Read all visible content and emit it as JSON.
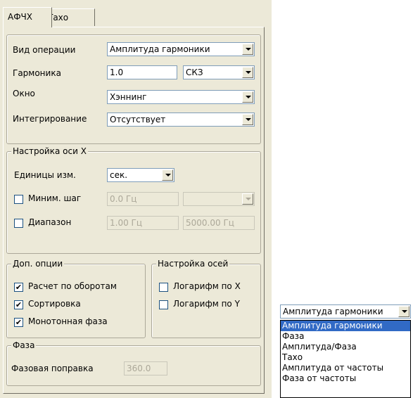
{
  "tabs": [
    {
      "label": "АФЧХ",
      "active": true
    },
    {
      "label": "Тахо",
      "active": false
    }
  ],
  "operation": {
    "vid_label": "Вид операции",
    "vid_value": "Амплитуда гармоники",
    "garmonika_label": "Гармоника",
    "garmonika_value": "1.0",
    "garmonika_unit": "СКЗ",
    "okno_label": "Окно",
    "okno_value": "Хэннинг",
    "integr_label": "Интегрирование",
    "integr_value": "Отсутствует"
  },
  "axis_x": {
    "legend": "Настройка оси X",
    "units_label": "Единицы изм.",
    "units_value": "сек.",
    "min_step_label": "Миним. шаг",
    "min_step_checked": false,
    "min_step_value": "0.0 Гц",
    "min_step_combo": "",
    "range_label": "Диапазон",
    "range_checked": false,
    "range_from": "1.00 Гц",
    "range_to": "5000.00 Гц"
  },
  "options": {
    "legend": "Доп. опции",
    "items": [
      {
        "label": "Расчет по оборотам",
        "checked": true
      },
      {
        "label": "Сортировка",
        "checked": true
      },
      {
        "label": "Монотонная фаза",
        "checked": true
      }
    ]
  },
  "axes": {
    "legend": "Настройка осей",
    "items": [
      {
        "label": "Логарифм по X",
        "checked": false
      },
      {
        "label": "Логарифм по Y",
        "checked": false
      }
    ]
  },
  "phase": {
    "legend": "Фаза",
    "correction_label": "Фазовая поправка",
    "correction_value": "360.0"
  },
  "dropdown": {
    "value": "Амплитуда гармоники",
    "options": [
      "Амплитуда гармоники",
      "Фаза",
      "Амплитуда/Фаза",
      "Тахо",
      "Амплитуда от частоты",
      "Фаза от частоты"
    ],
    "selected_index": 0
  },
  "icons": {
    "combo_arrow": "chevron-down-icon",
    "checkbox_mark": "checkmark-icon"
  },
  "colors": {
    "panel_bg": "#ece9d8",
    "selection": "#316ac5",
    "field_border": "#7f9db9"
  }
}
